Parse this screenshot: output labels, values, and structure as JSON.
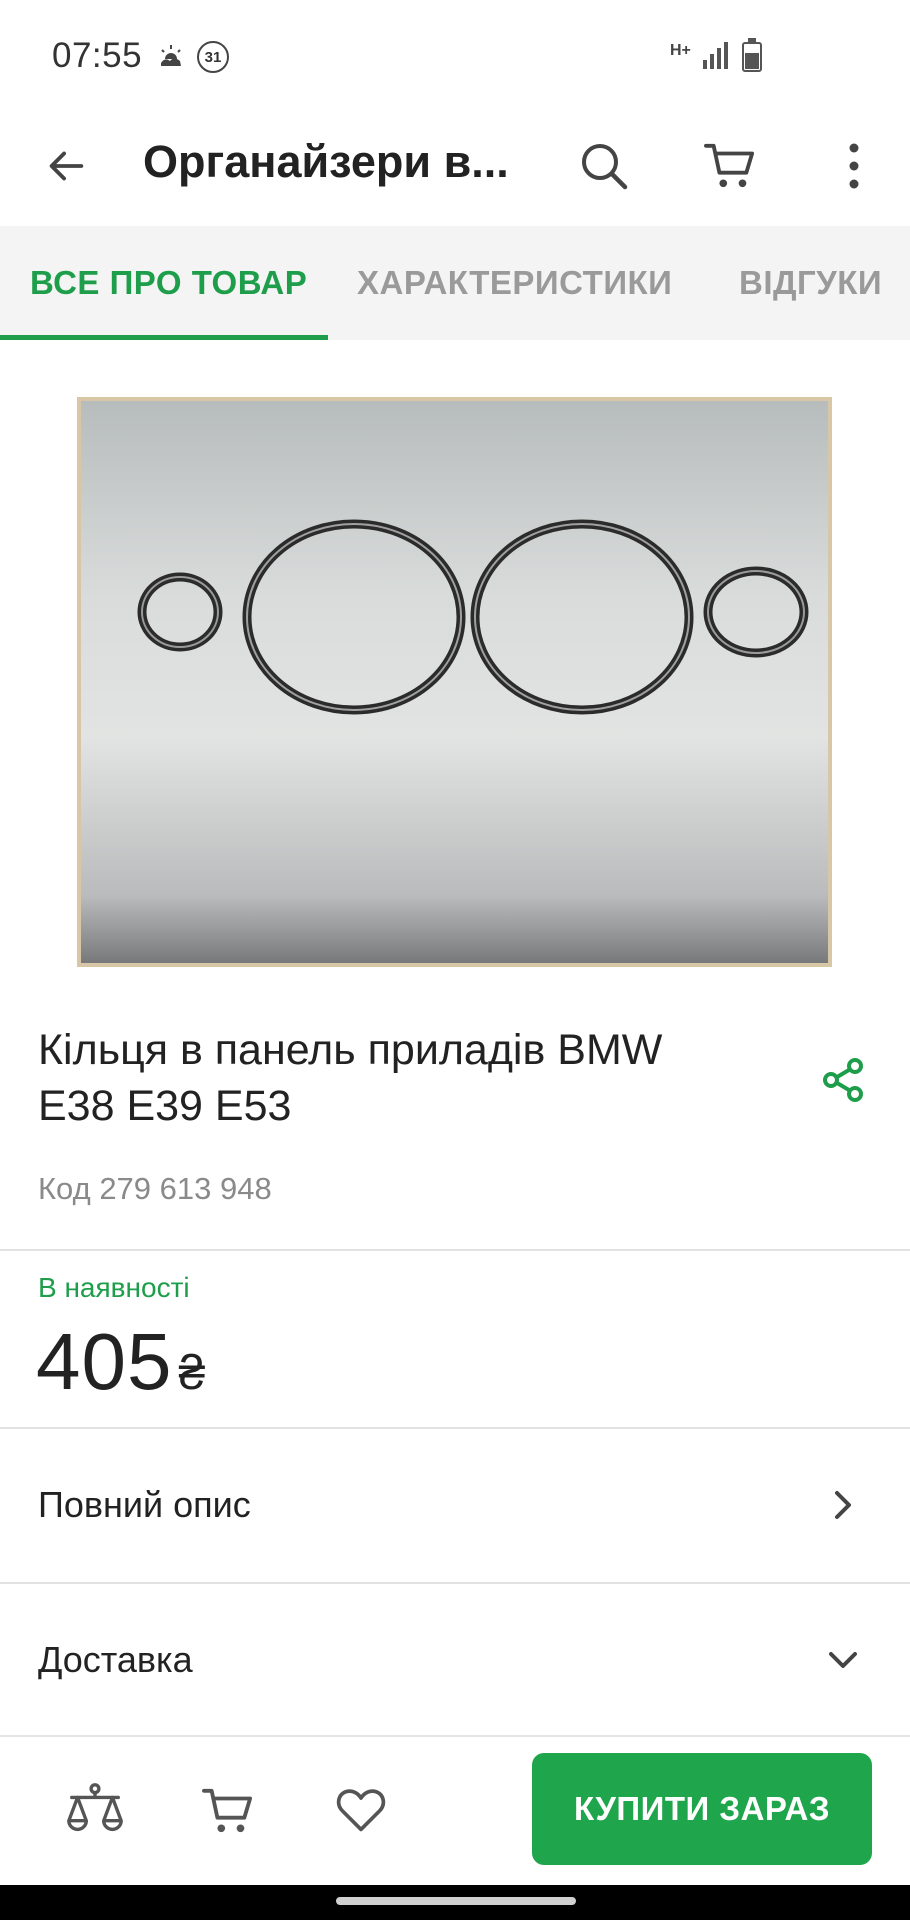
{
  "status_bar": {
    "time": "07:55",
    "weather_icon": "sunrise-cloud-icon",
    "calendar_badge": "31",
    "network_type": "H+",
    "signal_icon": "signal-icon",
    "battery_icon": "battery-icon"
  },
  "app_bar": {
    "title": "Органайзери в...",
    "back_icon": "arrow-left-icon",
    "search_icon": "search-icon",
    "cart_icon": "cart-icon",
    "more_icon": "more-vertical-icon"
  },
  "tabs": [
    {
      "label": "ВСЕ ПРО ТОВАР",
      "active": true
    },
    {
      "label": "ХАРАКТЕРИСТИКИ",
      "active": false
    },
    {
      "label": "ВІДГУКИ",
      "active": false
    }
  ],
  "product": {
    "image_alt": "product-photo-rings",
    "title": "Кільця в панель приладів BMW E38 E39 E53",
    "code": "Код 279 613 948",
    "stock": "В наявності",
    "price": "405",
    "currency": "₴"
  },
  "sections": [
    {
      "label": "Повний опис",
      "icon": "chevron-right-icon"
    },
    {
      "label": "Доставка",
      "icon": "chevron-down-icon"
    }
  ],
  "bottom_bar": {
    "compare_icon": "compare-scales-icon",
    "cart_icon": "cart-icon",
    "wishlist_icon": "heart-icon",
    "buy_label": "КУПИТИ ЗАРАЗ"
  },
  "colors": {
    "accent": "#1e9e4a",
    "buy_button": "#1fa64c",
    "muted_text": "#8a8a8a",
    "tab_background": "#f4f4f4"
  }
}
